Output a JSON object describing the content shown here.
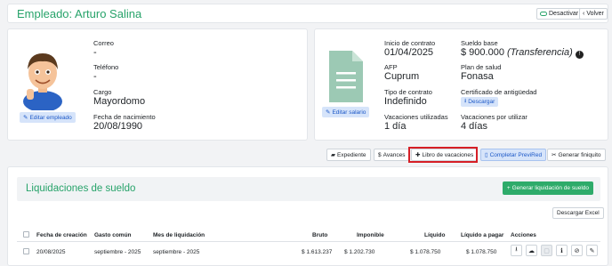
{
  "header": {
    "title": "Empleado: Arturo Salina",
    "deactivate_label": "Desactivar",
    "back_label": "Volver"
  },
  "employee": {
    "email_label": "Correo",
    "email_value": "-",
    "phone_label": "Teléfono",
    "phone_value": "-",
    "role_label": "Cargo",
    "role_value": "Mayordomo",
    "birth_label": "Fecha de nacimiento",
    "birth_value": "20/08/1990",
    "edit_label": "Editar empleado"
  },
  "contract": {
    "start_label": "Inicio de contrato",
    "start_value": "01/04/2025",
    "salary_label": "Sueldo base",
    "salary_value": "$ 900.000",
    "salary_method": "(Transferencia)",
    "afp_label": "AFP",
    "afp_value": "Cuprum",
    "health_label": "Plan de salud",
    "health_value": "Fonasa",
    "type_label": "Tipo de contrato",
    "type_value": "Indefinido",
    "cert_label": "Certificado de antigüedad",
    "download_label": "Descargar",
    "used_label": "Vacaciones utilizadas",
    "used_value": "1 día",
    "pending_label": "Vacaciones por utilizar",
    "pending_value": "4 días",
    "edit_salary_label": "Editar salario"
  },
  "toolbar": {
    "expediente": "Expediente",
    "avances": "Avances",
    "libro": "Libro de vacaciones",
    "previred": "Completar PreviRed",
    "finiquito": "Generar finiquito"
  },
  "settlements": {
    "title": "Liquidaciones de sueldo",
    "generate_label": "Generar liquidación de sueldo",
    "download_excel": "Descargar Excel",
    "columns": [
      "Fecha de creación",
      "Gasto común",
      "Mes de liquidación",
      "Bruto",
      "Imponible",
      "Líquido",
      "Líquido a pagar",
      "Acciones"
    ],
    "rows": [
      [
        "20/08/2025",
        "septiembre - 2025",
        "septiembre - 2025",
        "$ 1.613.237",
        "$ 1.202.730",
        "$ 1.078.750",
        "$ 1.078.750"
      ]
    ]
  },
  "colors": {
    "accent": "#27a36a",
    "primary": "#1c58c7",
    "highlight": "#d61f26"
  }
}
